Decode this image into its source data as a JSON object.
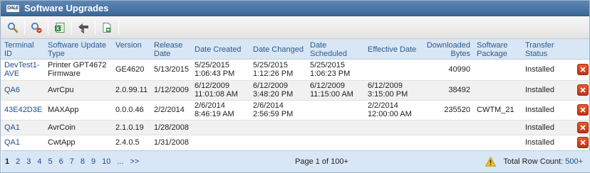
{
  "window": {
    "title": "Software Upgrades",
    "logo_text": "OALE"
  },
  "toolbar": {
    "buttons": [
      {
        "name": "search",
        "icon": "magnifier-icon"
      },
      {
        "name": "clear-search",
        "icon": "magnifier-remove-icon"
      },
      {
        "name": "export-excel",
        "icon": "excel-export-icon"
      },
      {
        "name": "download",
        "icon": "download-arrow-icon"
      },
      {
        "name": "new",
        "icon": "new-document-icon"
      }
    ]
  },
  "table": {
    "headers": [
      "Terminal ID",
      "Software Update Type",
      "Version",
      "Release Date",
      "Date Created",
      "Date Changed",
      "Date Scheduled",
      "Effective Date",
      "Downloaded Bytes",
      "Software Package",
      "Transfer Status"
    ],
    "rows": [
      {
        "terminal_id": "DevTest1-AVE",
        "update_type": "Printer GPT4672 Firmware",
        "version": "GE4620",
        "release_date": "5/13/2015",
        "date_created": "5/25/2015 1:06:43 PM",
        "date_changed": "5/25/2015 1:12:26 PM",
        "date_scheduled": "5/25/2015 1:06:23 PM",
        "effective_date": "",
        "downloaded_bytes": "40990",
        "software_package": "",
        "transfer_status": "Installed"
      },
      {
        "terminal_id": "QA6",
        "update_type": "AvrCpu",
        "version": "2.0.99.11",
        "release_date": "1/12/2009",
        "date_created": "6/12/2009 11:01:08 AM",
        "date_changed": "6/12/2009 3:48:20 PM",
        "date_scheduled": "6/12/2009 11:15:00 AM",
        "effective_date": "6/12/2009 3:15:00 PM",
        "downloaded_bytes": "38492",
        "software_package": "",
        "transfer_status": "Installed"
      },
      {
        "terminal_id": "43E42D3E",
        "update_type": "MAXApp",
        "version": "0.0.0.46",
        "release_date": "2/2/2014",
        "date_created": "2/6/2014 8:46:19 AM",
        "date_changed": "2/6/2014 2:56:59 PM",
        "date_scheduled": "",
        "effective_date": "2/2/2014 12:00:00 AM",
        "downloaded_bytes": "235520",
        "software_package": "CWTM_21",
        "transfer_status": "Installed"
      },
      {
        "terminal_id": "QA1",
        "update_type": "AvrCoin",
        "version": "2.1.0.19",
        "release_date": "1/28/2008",
        "date_created": "",
        "date_changed": "",
        "date_scheduled": "",
        "effective_date": "",
        "downloaded_bytes": "",
        "software_package": "",
        "transfer_status": "Installed"
      },
      {
        "terminal_id": "QA1",
        "update_type": "CwtApp",
        "version": "2.4.0.5",
        "release_date": "1/31/2008",
        "date_created": "",
        "date_changed": "",
        "date_scheduled": "",
        "effective_date": "",
        "downloaded_bytes": "",
        "software_package": "",
        "transfer_status": "Installed"
      }
    ]
  },
  "pager": {
    "pages": [
      "1",
      "2",
      "3",
      "4",
      "5",
      "6",
      "7",
      "8",
      "9",
      "10",
      "...",
      ">>"
    ],
    "current": "1",
    "page_info": "Page 1 of 100+",
    "row_count_label": "Total Row Count:",
    "row_count_value": "500+"
  },
  "colors": {
    "title_bar": "#4a76a6",
    "header_bg": "#d8e6f5",
    "link": "#1f4e8c",
    "delete_button": "#d9441f"
  }
}
